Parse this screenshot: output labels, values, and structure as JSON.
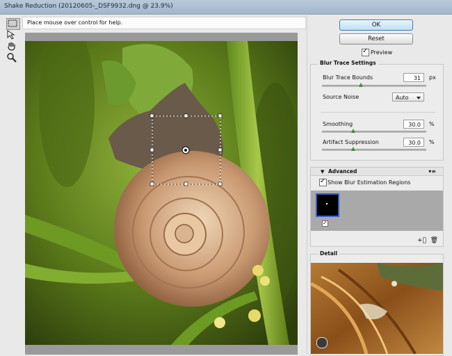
{
  "window": {
    "title": "Shake Reduction (20120605-_DSF9932.dng @ 23.9%)"
  },
  "toolbar": {
    "tools": [
      "blur-estimation-tool",
      "blur-direction-tool",
      "hand-tool",
      "zoom-tool"
    ]
  },
  "hint": "Place mouse over control for help.",
  "buttons": {
    "ok": "OK",
    "reset": "Reset"
  },
  "preview": {
    "label": "Preview",
    "checked": true
  },
  "blur_trace": {
    "header": "Blur Trace Settings",
    "bounds_label": "Blur Trace Bounds",
    "bounds_value": "31",
    "bounds_unit": "px",
    "noise_label": "Source Noise",
    "noise_value": "Auto",
    "smoothing_label": "Smoothing",
    "smoothing_value": "30.0",
    "smoothing_unit": "%",
    "artifact_label": "Artifact Suppression",
    "artifact_value": "30.0",
    "artifact_unit": "%"
  },
  "advanced": {
    "header": "Advanced",
    "show_regions_label": "Show Blur Estimation Regions",
    "show_regions_checked": true,
    "region_enabled": true
  },
  "detail": {
    "header": "Detail"
  },
  "colors": {
    "ok_border": "#3c7fb1",
    "slider_thumb": "#3b8f3b",
    "region_border": "#2f5fd0"
  }
}
